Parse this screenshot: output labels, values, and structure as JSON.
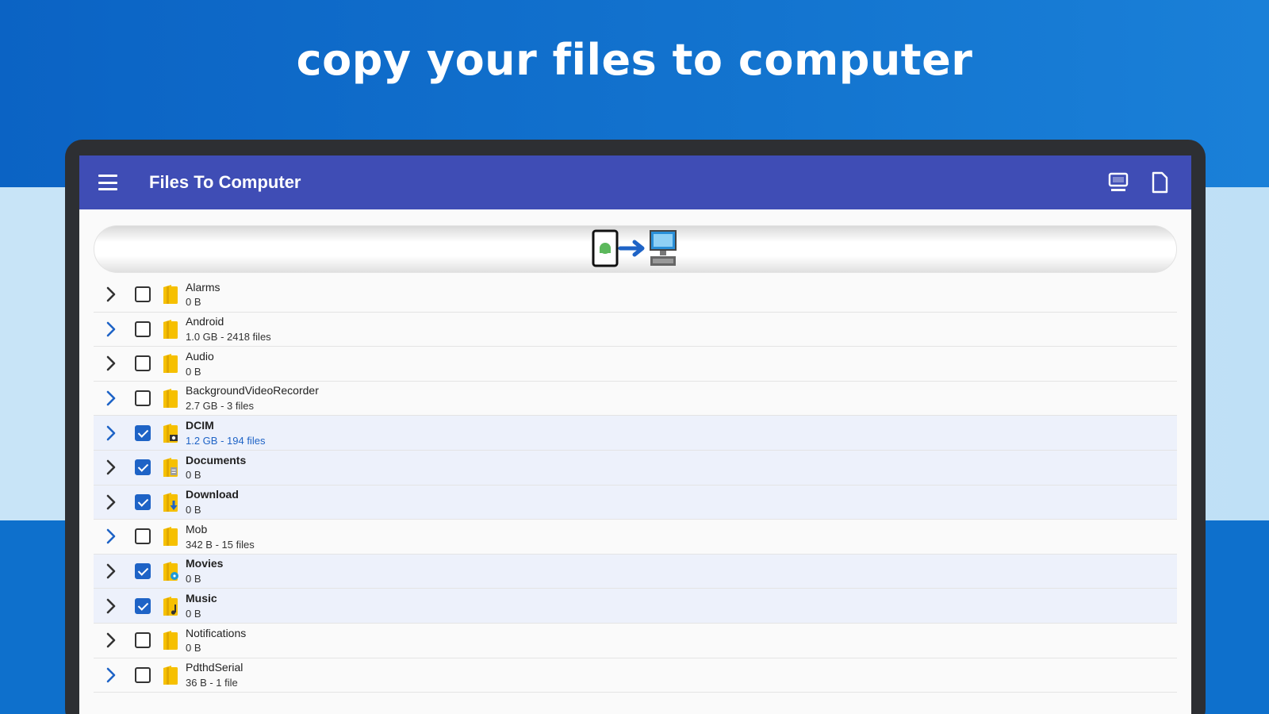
{
  "headline": "copy your files to computer",
  "app": {
    "title": "Files To Computer",
    "menu_icon": "hamburger-menu-icon",
    "actions": [
      "computer-icon",
      "file-icon"
    ]
  },
  "transfer_button": {
    "icon": "phone-to-computer-icon"
  },
  "colors": {
    "appbar": "#3f4db5",
    "background": "#0f6bc8",
    "checkbox_on": "#1e63c6",
    "folder": "#f6c000",
    "highlight_meta": "#1e63c6"
  },
  "folders": [
    {
      "name": "Alarms",
      "meta": "0 B",
      "checked": false,
      "chevron_color": "#333333",
      "badge": ""
    },
    {
      "name": "Android",
      "meta": "1.0 GB - 2418 files",
      "checked": false,
      "chevron_color": "#1e63c6",
      "badge": ""
    },
    {
      "name": "Audio",
      "meta": "0 B",
      "checked": false,
      "chevron_color": "#333333",
      "badge": ""
    },
    {
      "name": "BackgroundVideoRecorder",
      "meta": "2.7 GB - 3 files",
      "checked": false,
      "chevron_color": "#1e63c6",
      "badge": ""
    },
    {
      "name": "DCIM",
      "meta": "1.2 GB - 194 files",
      "checked": true,
      "chevron_color": "#1e63c6",
      "badge": "camera"
    },
    {
      "name": "Documents",
      "meta": "0 B",
      "checked": true,
      "chevron_color": "#333333",
      "badge": "doc"
    },
    {
      "name": "Download",
      "meta": "0 B",
      "checked": true,
      "chevron_color": "#333333",
      "badge": "download"
    },
    {
      "name": "Mob",
      "meta": "342 B - 15 files",
      "checked": false,
      "chevron_color": "#1e63c6",
      "badge": ""
    },
    {
      "name": "Movies",
      "meta": "0 B",
      "checked": true,
      "chevron_color": "#333333",
      "badge": "movie"
    },
    {
      "name": "Music",
      "meta": "0 B",
      "checked": true,
      "chevron_color": "#333333",
      "badge": "music"
    },
    {
      "name": "Notifications",
      "meta": "0 B",
      "checked": false,
      "chevron_color": "#333333",
      "badge": ""
    },
    {
      "name": "PdthdSerial",
      "meta": "36 B - 1 file",
      "checked": false,
      "chevron_color": "#1e63c6",
      "badge": ""
    }
  ]
}
